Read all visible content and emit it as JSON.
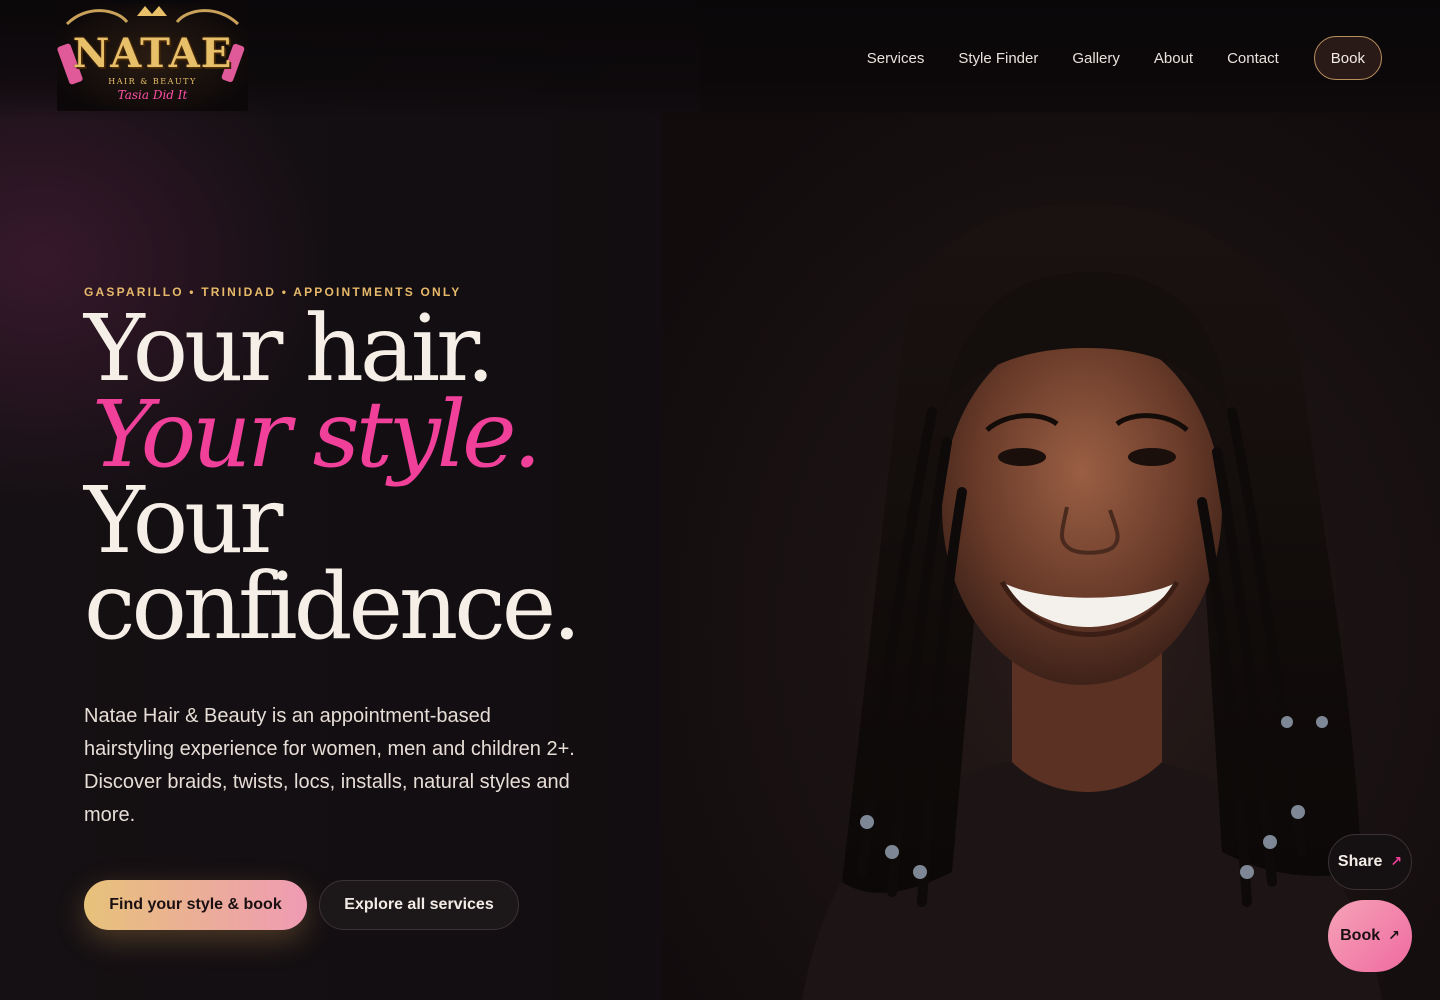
{
  "brand": {
    "name": "NATAE",
    "subtitle": "HAIR & BEAUTY",
    "signature": "Tasia Did It"
  },
  "nav": {
    "items": [
      {
        "label": "Services"
      },
      {
        "label": "Style Finder"
      },
      {
        "label": "Gallery"
      },
      {
        "label": "About"
      },
      {
        "label": "Contact"
      }
    ],
    "book_label": "Book"
  },
  "hero": {
    "eyebrow": "GASPARILLO • TRINIDAD • APPOINTMENTS ONLY",
    "headline": {
      "line1": "Your hair.",
      "line2": "Your style.",
      "line3": "Your",
      "line4": "confidence."
    },
    "lead": "Natae Hair & Beauty is an appointment-based hairstyling experience for women, men and children 2+. Discover braids, twists, locs, installs, natural styles and more.",
    "cta_primary": "Find your style & book",
    "cta_secondary": "Explore all services",
    "photo_alt": "smiling woman with braided hair"
  },
  "floating": {
    "share_label": "Share",
    "book_label": "Book",
    "arrow_icon": "↗"
  },
  "colors": {
    "background": "#0f0b0d",
    "accent_pink": "#f0409a",
    "accent_gold": "#e7b96a",
    "text": "#f6efe8"
  }
}
